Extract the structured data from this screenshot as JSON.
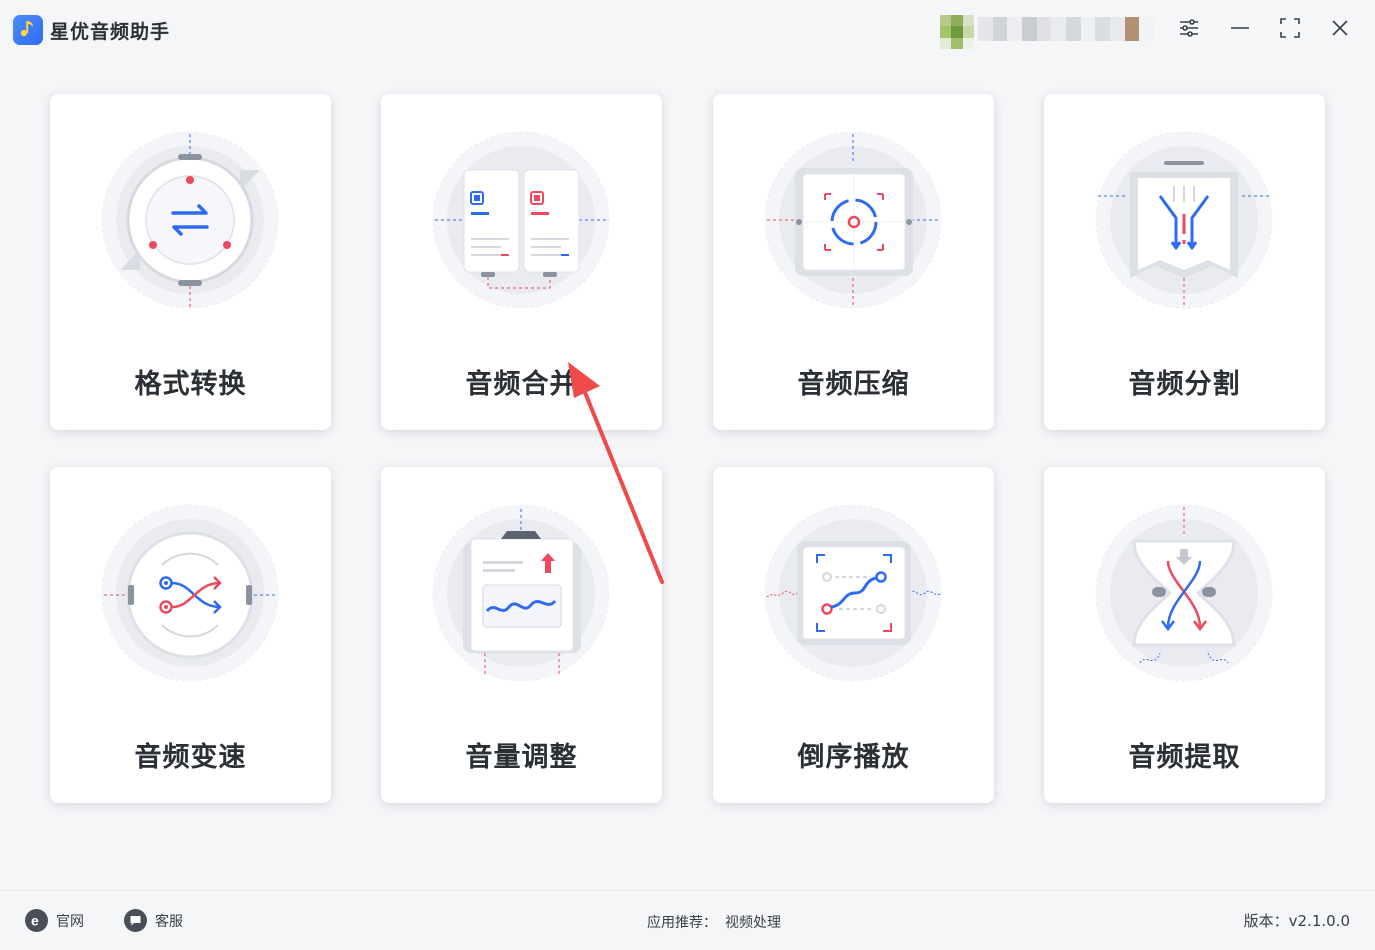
{
  "app": {
    "title": "星优音频助手",
    "logo_icon": "music-note-icon",
    "brand_color": "#3d7bfa"
  },
  "header": {
    "settings_icon": "sliders-icon",
    "minimize_icon": "minimize-icon",
    "maximize_icon": "maximize-icon",
    "close_icon": "close-icon"
  },
  "features": [
    {
      "label": "格式转换",
      "icon": "format-convert-icon"
    },
    {
      "label": "音频合并",
      "icon": "audio-merge-icon"
    },
    {
      "label": "音频压缩",
      "icon": "audio-compress-icon"
    },
    {
      "label": "音频分割",
      "icon": "audio-split-icon"
    },
    {
      "label": "音频变速",
      "icon": "audio-speed-icon"
    },
    {
      "label": "音量调整",
      "icon": "volume-adjust-icon"
    },
    {
      "label": "倒序播放",
      "icon": "reverse-play-icon"
    },
    {
      "label": "音频提取",
      "icon": "audio-extract-icon"
    }
  ],
  "footer": {
    "website_label": "官网",
    "support_label": "客服",
    "recommend_prefix": "应用推荐：",
    "recommend_link": "视频处理",
    "version_text": "版本：v2.1.0.0"
  },
  "colors": {
    "accent_blue": "#2f6bf2",
    "accent_red": "#f0485d",
    "annotation_arrow": "#ef4b4b"
  }
}
